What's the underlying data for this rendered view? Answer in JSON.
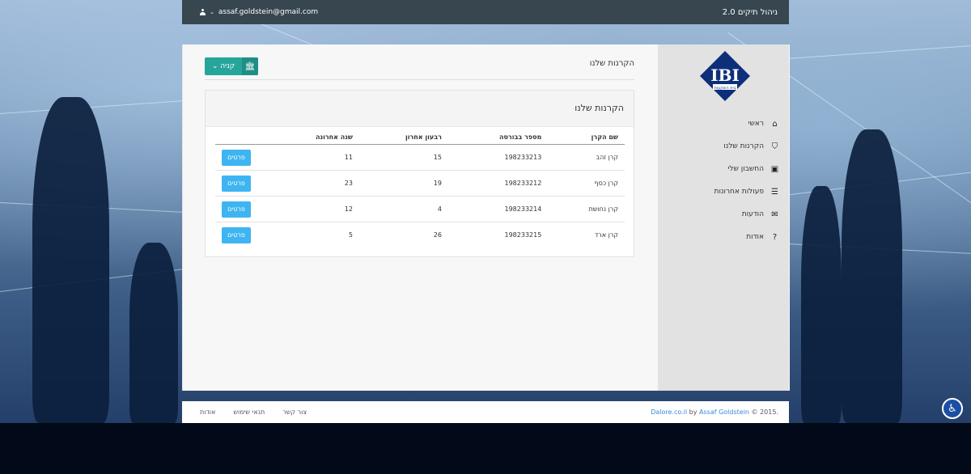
{
  "header": {
    "brand": "ניהול תיקים 2.0",
    "user_email": "assaf.goldstein@gmail.com"
  },
  "sidebar": {
    "logo_text": "IBI",
    "logo_subtext": "בית השקעות",
    "items": [
      {
        "label": "ראשי",
        "icon": "home-icon"
      },
      {
        "label": "הקרנות שלנו",
        "icon": "shield-icon"
      },
      {
        "label": "החשבון שלי",
        "icon": "briefcase-icon"
      },
      {
        "label": "פעולות אחרונות",
        "icon": "list-icon"
      },
      {
        "label": "הודעות",
        "icon": "envelope-icon"
      },
      {
        "label": "אודות",
        "icon": "question-icon"
      }
    ]
  },
  "main": {
    "page_title": "הקרנות שלנו",
    "buy_button": {
      "label": "קניה",
      "icon": "bank-icon"
    },
    "panel_title": "הקרנות שלנו",
    "table": {
      "headers": [
        "שם הקרן",
        "מספר בבורסה",
        "רבעון אחרון",
        "שנה אחרונה"
      ],
      "rows": [
        {
          "name": "קרן זהב",
          "number": "198233213",
          "quarter": "15",
          "year": "11",
          "action": "פרטים"
        },
        {
          "name": "קרן כסף",
          "number": "198233212",
          "quarter": "19",
          "year": "23",
          "action": "פרטים"
        },
        {
          "name": "קרן נחושת",
          "number": "198233214",
          "quarter": "4",
          "year": "12",
          "action": "פרטים"
        },
        {
          "name": "קרן ארד",
          "number": "198233215",
          "quarter": "26",
          "year": "5",
          "action": "פרטים"
        }
      ]
    }
  },
  "footer": {
    "links": [
      "צור קשר",
      "תנאי שימוש",
      "אודות"
    ],
    "copyright": "© 2015.",
    "author": "Assaf Goldstein",
    "by": "by",
    "site": "Dalore.co.il"
  },
  "colors": {
    "topbar": "#37464f",
    "buy_button": "#26a69a",
    "details_button": "#3eb5f1",
    "logo": "#0d2f7a"
  }
}
